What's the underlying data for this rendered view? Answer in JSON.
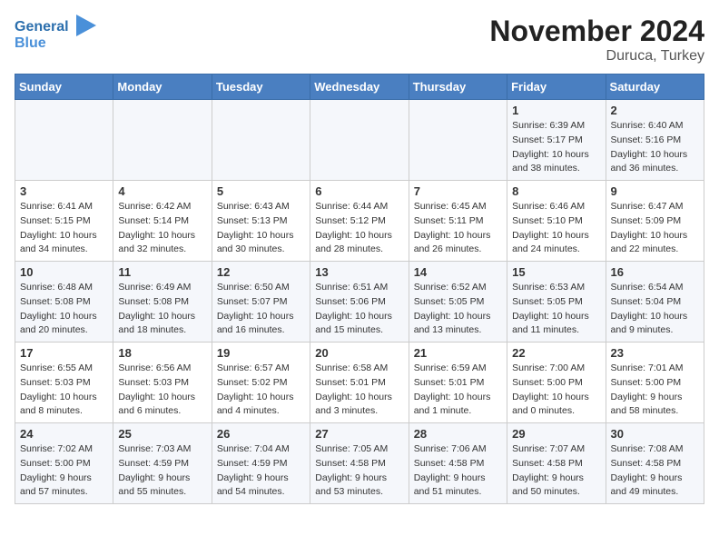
{
  "header": {
    "logo_general": "General",
    "logo_blue": "Blue",
    "month": "November 2024",
    "location": "Duruca, Turkey"
  },
  "days_of_week": [
    "Sunday",
    "Monday",
    "Tuesday",
    "Wednesday",
    "Thursday",
    "Friday",
    "Saturday"
  ],
  "weeks": [
    {
      "days": [
        {
          "date": "",
          "content": ""
        },
        {
          "date": "",
          "content": ""
        },
        {
          "date": "",
          "content": ""
        },
        {
          "date": "",
          "content": ""
        },
        {
          "date": "",
          "content": ""
        },
        {
          "date": "1",
          "content": "Sunrise: 6:39 AM\nSunset: 5:17 PM\nDaylight: 10 hours\nand 38 minutes."
        },
        {
          "date": "2",
          "content": "Sunrise: 6:40 AM\nSunset: 5:16 PM\nDaylight: 10 hours\nand 36 minutes."
        }
      ]
    },
    {
      "days": [
        {
          "date": "3",
          "content": "Sunrise: 6:41 AM\nSunset: 5:15 PM\nDaylight: 10 hours\nand 34 minutes."
        },
        {
          "date": "4",
          "content": "Sunrise: 6:42 AM\nSunset: 5:14 PM\nDaylight: 10 hours\nand 32 minutes."
        },
        {
          "date": "5",
          "content": "Sunrise: 6:43 AM\nSunset: 5:13 PM\nDaylight: 10 hours\nand 30 minutes."
        },
        {
          "date": "6",
          "content": "Sunrise: 6:44 AM\nSunset: 5:12 PM\nDaylight: 10 hours\nand 28 minutes."
        },
        {
          "date": "7",
          "content": "Sunrise: 6:45 AM\nSunset: 5:11 PM\nDaylight: 10 hours\nand 26 minutes."
        },
        {
          "date": "8",
          "content": "Sunrise: 6:46 AM\nSunset: 5:10 PM\nDaylight: 10 hours\nand 24 minutes."
        },
        {
          "date": "9",
          "content": "Sunrise: 6:47 AM\nSunset: 5:09 PM\nDaylight: 10 hours\nand 22 minutes."
        }
      ]
    },
    {
      "days": [
        {
          "date": "10",
          "content": "Sunrise: 6:48 AM\nSunset: 5:08 PM\nDaylight: 10 hours\nand 20 minutes."
        },
        {
          "date": "11",
          "content": "Sunrise: 6:49 AM\nSunset: 5:08 PM\nDaylight: 10 hours\nand 18 minutes."
        },
        {
          "date": "12",
          "content": "Sunrise: 6:50 AM\nSunset: 5:07 PM\nDaylight: 10 hours\nand 16 minutes."
        },
        {
          "date": "13",
          "content": "Sunrise: 6:51 AM\nSunset: 5:06 PM\nDaylight: 10 hours\nand 15 minutes."
        },
        {
          "date": "14",
          "content": "Sunrise: 6:52 AM\nSunset: 5:05 PM\nDaylight: 10 hours\nand 13 minutes."
        },
        {
          "date": "15",
          "content": "Sunrise: 6:53 AM\nSunset: 5:05 PM\nDaylight: 10 hours\nand 11 minutes."
        },
        {
          "date": "16",
          "content": "Sunrise: 6:54 AM\nSunset: 5:04 PM\nDaylight: 10 hours\nand 9 minutes."
        }
      ]
    },
    {
      "days": [
        {
          "date": "17",
          "content": "Sunrise: 6:55 AM\nSunset: 5:03 PM\nDaylight: 10 hours\nand 8 minutes."
        },
        {
          "date": "18",
          "content": "Sunrise: 6:56 AM\nSunset: 5:03 PM\nDaylight: 10 hours\nand 6 minutes."
        },
        {
          "date": "19",
          "content": "Sunrise: 6:57 AM\nSunset: 5:02 PM\nDaylight: 10 hours\nand 4 minutes."
        },
        {
          "date": "20",
          "content": "Sunrise: 6:58 AM\nSunset: 5:01 PM\nDaylight: 10 hours\nand 3 minutes."
        },
        {
          "date": "21",
          "content": "Sunrise: 6:59 AM\nSunset: 5:01 PM\nDaylight: 10 hours\nand 1 minute."
        },
        {
          "date": "22",
          "content": "Sunrise: 7:00 AM\nSunset: 5:00 PM\nDaylight: 10 hours\nand 0 minutes."
        },
        {
          "date": "23",
          "content": "Sunrise: 7:01 AM\nSunset: 5:00 PM\nDaylight: 9 hours\nand 58 minutes."
        }
      ]
    },
    {
      "days": [
        {
          "date": "24",
          "content": "Sunrise: 7:02 AM\nSunset: 5:00 PM\nDaylight: 9 hours\nand 57 minutes."
        },
        {
          "date": "25",
          "content": "Sunrise: 7:03 AM\nSunset: 4:59 PM\nDaylight: 9 hours\nand 55 minutes."
        },
        {
          "date": "26",
          "content": "Sunrise: 7:04 AM\nSunset: 4:59 PM\nDaylight: 9 hours\nand 54 minutes."
        },
        {
          "date": "27",
          "content": "Sunrise: 7:05 AM\nSunset: 4:58 PM\nDaylight: 9 hours\nand 53 minutes."
        },
        {
          "date": "28",
          "content": "Sunrise: 7:06 AM\nSunset: 4:58 PM\nDaylight: 9 hours\nand 51 minutes."
        },
        {
          "date": "29",
          "content": "Sunrise: 7:07 AM\nSunset: 4:58 PM\nDaylight: 9 hours\nand 50 minutes."
        },
        {
          "date": "30",
          "content": "Sunrise: 7:08 AM\nSunset: 4:58 PM\nDaylight: 9 hours\nand 49 minutes."
        }
      ]
    }
  ]
}
